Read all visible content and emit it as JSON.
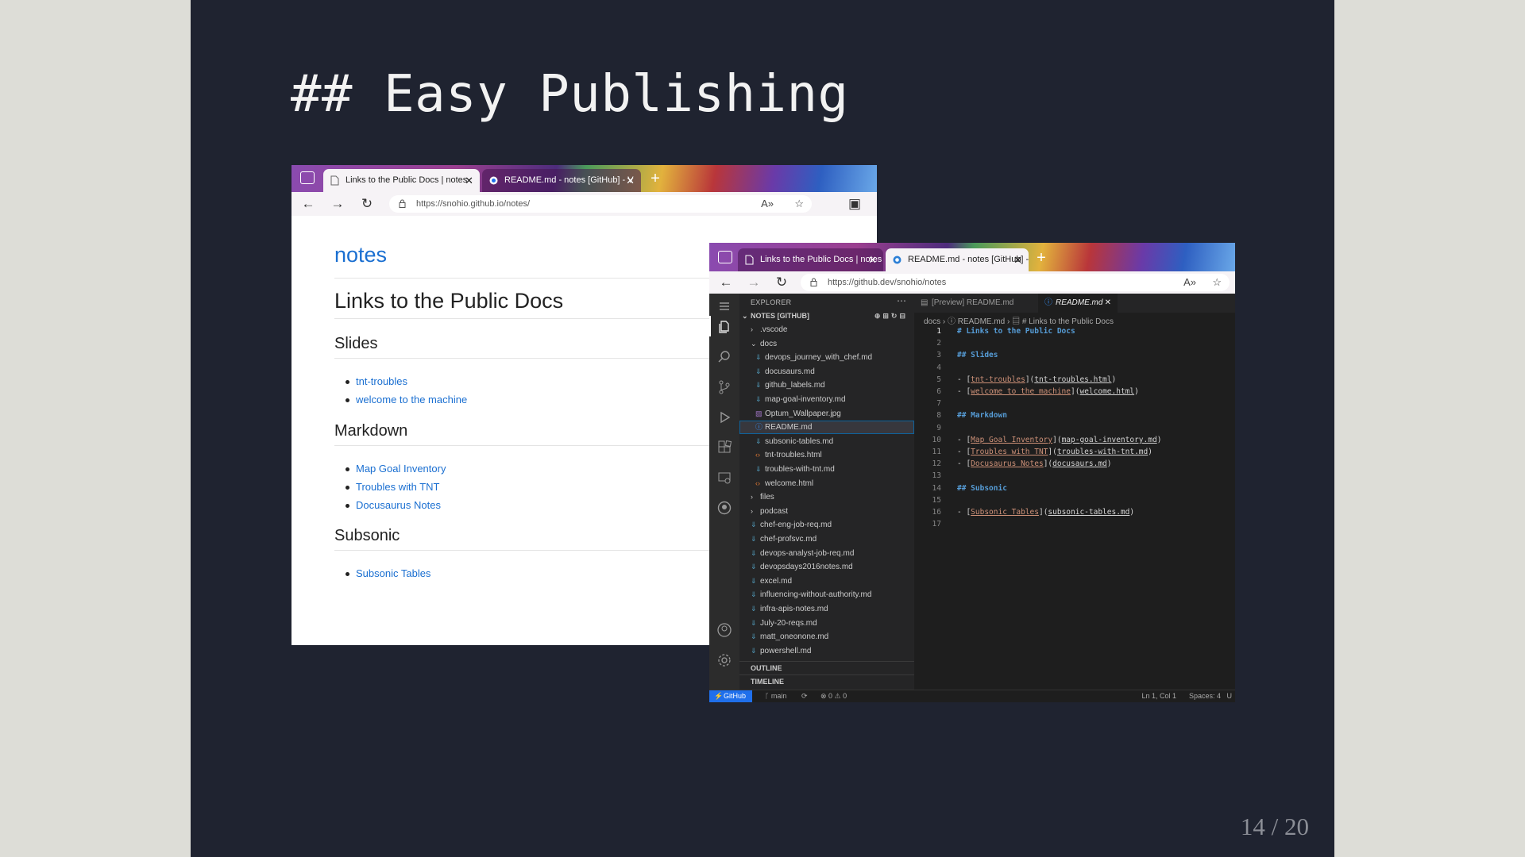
{
  "slide": {
    "title": "## Easy Publishing",
    "page_number": "14 / 20"
  },
  "browser1": {
    "tabs": [
      {
        "label": "Links to the Public Docs | notes",
        "active": true
      },
      {
        "label": "README.md - notes [GitHub] - V",
        "active": false
      }
    ],
    "url": "https://snohio.github.io/notes/",
    "site_title": "notes",
    "heading": "Links to the Public Docs",
    "sections": [
      {
        "title": "Slides",
        "links": [
          "tnt-troubles",
          "welcome to the machine"
        ]
      },
      {
        "title": "Markdown",
        "links": [
          "Map Goal Inventory",
          "Troubles with TNT",
          "Docusaurus Notes"
        ]
      },
      {
        "title": "Subsonic",
        "links": [
          "Subsonic Tables"
        ]
      }
    ]
  },
  "browser2": {
    "tabs": [
      {
        "label": "Links to the Public Docs | notes",
        "active": false
      },
      {
        "label": "README.md - notes [GitHub] - V",
        "active": true
      }
    ],
    "url": "https://github.dev/snohio/notes",
    "explorer": {
      "header": "EXPLORER",
      "root": "NOTES [GITHUB]",
      "items": [
        {
          "name": ".vscode",
          "type": "folder",
          "depth": 1,
          "open": false
        },
        {
          "name": "docs",
          "type": "folder",
          "depth": 1,
          "open": true
        },
        {
          "name": "devops_journey_with_chef.md",
          "type": "md",
          "depth": 2
        },
        {
          "name": "docusaurs.md",
          "type": "md",
          "depth": 2
        },
        {
          "name": "github_labels.md",
          "type": "md",
          "depth": 2
        },
        {
          "name": "map-goal-inventory.md",
          "type": "md",
          "depth": 2
        },
        {
          "name": "Optum_Wallpaper.jpg",
          "type": "img",
          "depth": 2
        },
        {
          "name": "README.md",
          "type": "info",
          "depth": 2,
          "selected": true
        },
        {
          "name": "subsonic-tables.md",
          "type": "md",
          "depth": 2
        },
        {
          "name": "tnt-troubles.html",
          "type": "html",
          "depth": 2
        },
        {
          "name": "troubles-with-tnt.md",
          "type": "md",
          "depth": 2
        },
        {
          "name": "welcome.html",
          "type": "html",
          "depth": 2
        },
        {
          "name": "files",
          "type": "folder",
          "depth": 1,
          "open": false
        },
        {
          "name": "podcast",
          "type": "folder",
          "depth": 1,
          "open": false
        },
        {
          "name": "chef-eng-job-req.md",
          "type": "md",
          "depth": 1
        },
        {
          "name": "chef-profsvc.md",
          "type": "md",
          "depth": 1
        },
        {
          "name": "devops-analyst-job-req.md",
          "type": "md",
          "depth": 1
        },
        {
          "name": "devopsdays2016notes.md",
          "type": "md",
          "depth": 1
        },
        {
          "name": "excel.md",
          "type": "md",
          "depth": 1
        },
        {
          "name": "influencing-without-authority.md",
          "type": "md",
          "depth": 1
        },
        {
          "name": "infra-apis-notes.md",
          "type": "md",
          "depth": 1
        },
        {
          "name": "July-20-reqs.md",
          "type": "md",
          "depth": 1
        },
        {
          "name": "matt_oneonone.md",
          "type": "md",
          "depth": 1
        },
        {
          "name": "powershell.md",
          "type": "md",
          "depth": 1
        }
      ],
      "outline": "OUTLINE",
      "timeline": "TIMELINE"
    },
    "editor_tabs": [
      {
        "label": "[Preview] README.md",
        "active": false
      },
      {
        "label": "README.md",
        "active": true
      }
    ],
    "breadcrumbs": "docs  ›  ⓘ README.md  ›  ▤ # Links to the Public Docs",
    "code_lines": [
      {
        "n": "1",
        "kind": "h",
        "text": "# Links to the Public Docs"
      },
      {
        "n": "2",
        "kind": "blank",
        "text": ""
      },
      {
        "n": "3",
        "kind": "h",
        "text": "## Slides"
      },
      {
        "n": "4",
        "kind": "blank",
        "text": ""
      },
      {
        "n": "5",
        "kind": "link",
        "label": "tnt-troubles",
        "target": "tnt-troubles.html"
      },
      {
        "n": "6",
        "kind": "link",
        "label": "welcome to the machine",
        "target": "welcome.html"
      },
      {
        "n": "7",
        "kind": "blank",
        "text": ""
      },
      {
        "n": "8",
        "kind": "h",
        "text": "## Markdown"
      },
      {
        "n": "9",
        "kind": "blank",
        "text": ""
      },
      {
        "n": "10",
        "kind": "link",
        "label": "Map Goal Inventory",
        "target": "map-goal-inventory.md"
      },
      {
        "n": "11",
        "kind": "link",
        "label": "Troubles with TNT",
        "target": "troubles-with-tnt.md"
      },
      {
        "n": "12",
        "kind": "link",
        "label": "Docusaurus Notes",
        "target": "docusaurs.md"
      },
      {
        "n": "13",
        "kind": "blank",
        "text": ""
      },
      {
        "n": "14",
        "kind": "h",
        "text": "## Subsonic"
      },
      {
        "n": "15",
        "kind": "blank",
        "text": ""
      },
      {
        "n": "16",
        "kind": "link",
        "label": "Subsonic Tables",
        "target": "subsonic-tables.md"
      },
      {
        "n": "17",
        "kind": "blank",
        "text": ""
      }
    ],
    "status": {
      "remote": "GitHub",
      "branch": "main",
      "problems": "⊗ 0 ⚠ 0",
      "position": "Ln 1, Col 1",
      "spaces": "Spaces: 4",
      "encoding": "U"
    }
  },
  "colors": {
    "slide_bg": "#1f2330",
    "link": "#1a6fd1",
    "vscode_bg": "#1e1e1e",
    "status_accent": "#1f6feb"
  }
}
